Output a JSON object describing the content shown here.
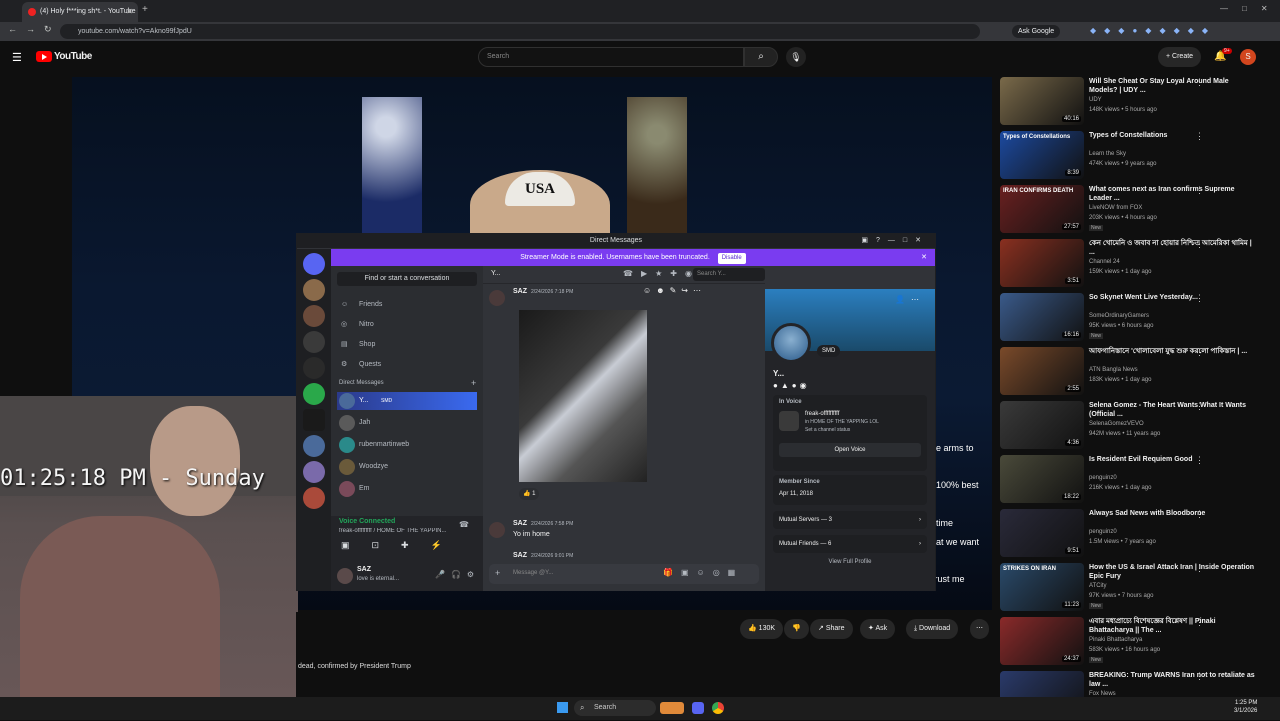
{
  "browser": {
    "tabs": [
      {
        "label": "(4) Holy f***ing sh*t. - YouTube",
        "active": true
      },
      {
        "label": "",
        "active": false
      }
    ],
    "url": "youtube.com/watch?v=Akno99fJpdU",
    "ask_google": "Ask Google"
  },
  "youtube": {
    "logo": "YouTube",
    "search_placeholder": "Search",
    "create_label": "Create",
    "notif_count": "9+",
    "avatar_letter": "S",
    "hat_text": "USA",
    "overlay_lines": [
      {
        "text": "e arms to"
      },
      {
        "text": "100% best"
      },
      {
        "text": "time"
      },
      {
        "text": "at we want"
      },
      {
        "text": "trust me"
      }
    ],
    "stream_clock": "01:25:18 PM - Sunday",
    "actions": {
      "likes": "130K",
      "share": "Share",
      "ask": "Ask",
      "download": "Download"
    },
    "caption": "dead, confirmed by President Trump",
    "recommendations": [
      {
        "title": "Will She Cheat Or Stay Loyal Around Male Models? | UDY ...",
        "channel": "UDY",
        "meta": "148K views • 5 hours ago",
        "duration": "40:16",
        "color": "#7a6a4a"
      },
      {
        "title": "Types of Constellations",
        "channel": "Learn the Sky",
        "meta": "474K views • 9 years ago",
        "duration": "8:39",
        "color": "#1c4aa0",
        "thumb_text": "Types of Constellations"
      },
      {
        "title": "What comes next as Iran confirms Supreme Leader ...",
        "channel": "LiveNOW from FOX",
        "meta": "203K views • 4 hours ago",
        "badge": "New",
        "duration": "27:57",
        "color": "#6a2020",
        "thumb_text": "IRAN CONFIRMS DEATH"
      },
      {
        "title": "কেন খোমেনি ও জবাব না হোয়ার নিশ্চিত আমেরিকা থামিম | ...",
        "channel": "Channel 24",
        "meta": "159K views • 1 day ago",
        "duration": "3:51",
        "color": "#8a3020"
      },
      {
        "title": "So Skynet Went Live Yesterday...",
        "channel": "SomeOrdinaryGamers",
        "meta": "95K views • 6 hours ago",
        "badge": "New",
        "duration": "16:16",
        "color": "#3a5a8a"
      },
      {
        "title": "আফগানিস্তানে 'খোলাবেলা যুদ্ধ শুরু করলো পাকিস্তান | ...",
        "channel": "ATN Bangla News",
        "meta": "183K views • 1 day ago",
        "duration": "2:55",
        "color": "#7a4a2a"
      },
      {
        "title": "Selena Gomez - The Heart Wants What It Wants (Official ...",
        "channel": "SelenaGomezVEVO",
        "meta": "942M views • 11 years ago",
        "duration": "4:36",
        "color": "#3a3a3a"
      },
      {
        "title": "Is Resident Evil Requiem Good",
        "channel": "penguinz0",
        "meta": "216K views • 1 day ago",
        "duration": "18:22",
        "color": "#4a4a3a"
      },
      {
        "title": "Always Sad News with Bloodborne",
        "channel": "penguinz0",
        "meta": "1.5M views • 7 years ago",
        "duration": "9:51",
        "color": "#2a2a3a"
      },
      {
        "title": "How the US & Israel Attack Iran | Inside Operation Epic Fury",
        "channel": "ATCity",
        "meta": "97K views • 7 hours ago",
        "badge": "New",
        "duration": "11:23",
        "color": "#2a4a6a",
        "thumb_text": "STRIKES ON IRAN"
      },
      {
        "title": "এবার মধ্যপ্রাচ্যে বিশেষজ্ঞের বিশ্লেষণ || Pinaki Bhattacharya || The ...",
        "channel": "Pinaki Bhattacharya",
        "meta": "583K views • 16 hours ago",
        "badge": "New",
        "duration": "24:37",
        "color": "#8a2a2a"
      },
      {
        "title": "BREAKING: Trump WARNS Iran not to retaliate as law ...",
        "channel": "Fox News",
        "meta": "",
        "duration": "",
        "color": "#2a3a6a"
      }
    ]
  },
  "discord": {
    "window_title": "Direct Messages",
    "banner": "Streamer Mode is enabled. Usernames have been truncated.",
    "disable_label": "Disable",
    "find_placeholder": "Find or start a conversation",
    "nav": [
      "Friends",
      "Nitro",
      "Shop",
      "Quests"
    ],
    "dm_header": "Direct Messages",
    "dms": [
      {
        "name": "Y...",
        "sub": "SMD",
        "color": "#4a6a9a",
        "active": true
      },
      {
        "name": "Jah",
        "sub": "",
        "color": "#5a5a5a"
      },
      {
        "name": "rubenmartinweb",
        "sub": "",
        "color": "#2a8a8a"
      },
      {
        "name": "Woodzye",
        "sub": "",
        "color": "#6a5a3a"
      },
      {
        "name": "Em",
        "sub": "",
        "color": "#7a4a5a"
      }
    ],
    "voice": {
      "status": "Voice Connected",
      "channel": "freak-offfffffff / HOME OF THE YAPPIN..."
    },
    "user": {
      "name": "SAZ",
      "status": "love is eternal..."
    },
    "chat": {
      "header_name": "Y...",
      "search_placeholder": "Search Y...",
      "messages": [
        {
          "author": "SAZ",
          "time": "2/24/2026 7:18 PM",
          "text": "",
          "reaction": "1"
        },
        {
          "author": "SAZ",
          "time": "2/24/2026 7:58 PM",
          "text": "Yo im home"
        },
        {
          "author": "SAZ",
          "time": "2/24/2026 9:01 PM",
          "text": ""
        }
      ],
      "input_placeholder": "Message @Y..."
    },
    "profile": {
      "name": "Y...",
      "tag": "SMD",
      "in_voice": "In Voice",
      "voice_channel": "freak-offffffffff",
      "voice_server": "in HOME OF THE YAPPING LOL",
      "set_status": "Set a channel status",
      "open_voice": "Open Voice",
      "member_since_label": "Member Since",
      "member_since": "Apr 11, 2018",
      "mutual_servers": "Mutual Servers — 3",
      "mutual_friends": "Mutual Friends — 6",
      "view_full": "View Full Profile"
    }
  },
  "taskbar": {
    "search": "Search",
    "time": "1:25 PM",
    "date": "3/1/2026"
  }
}
